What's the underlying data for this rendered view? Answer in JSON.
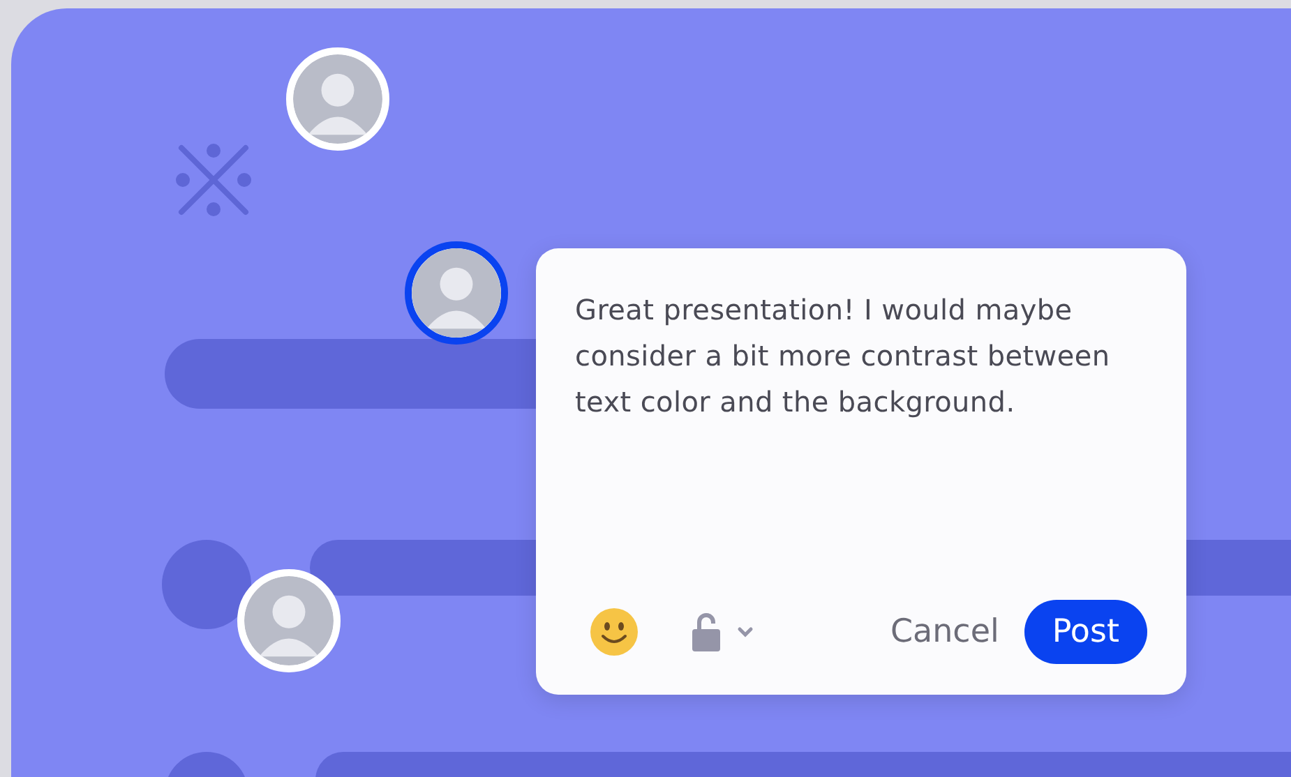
{
  "avatars": [
    {
      "selected": false
    },
    {
      "selected": true
    },
    {
      "selected": false
    }
  ],
  "comment": {
    "text": "Great presentation! I would maybe consider a bit more contrast between text color and the background.",
    "cancel": "Cancel",
    "post": "Post"
  }
}
